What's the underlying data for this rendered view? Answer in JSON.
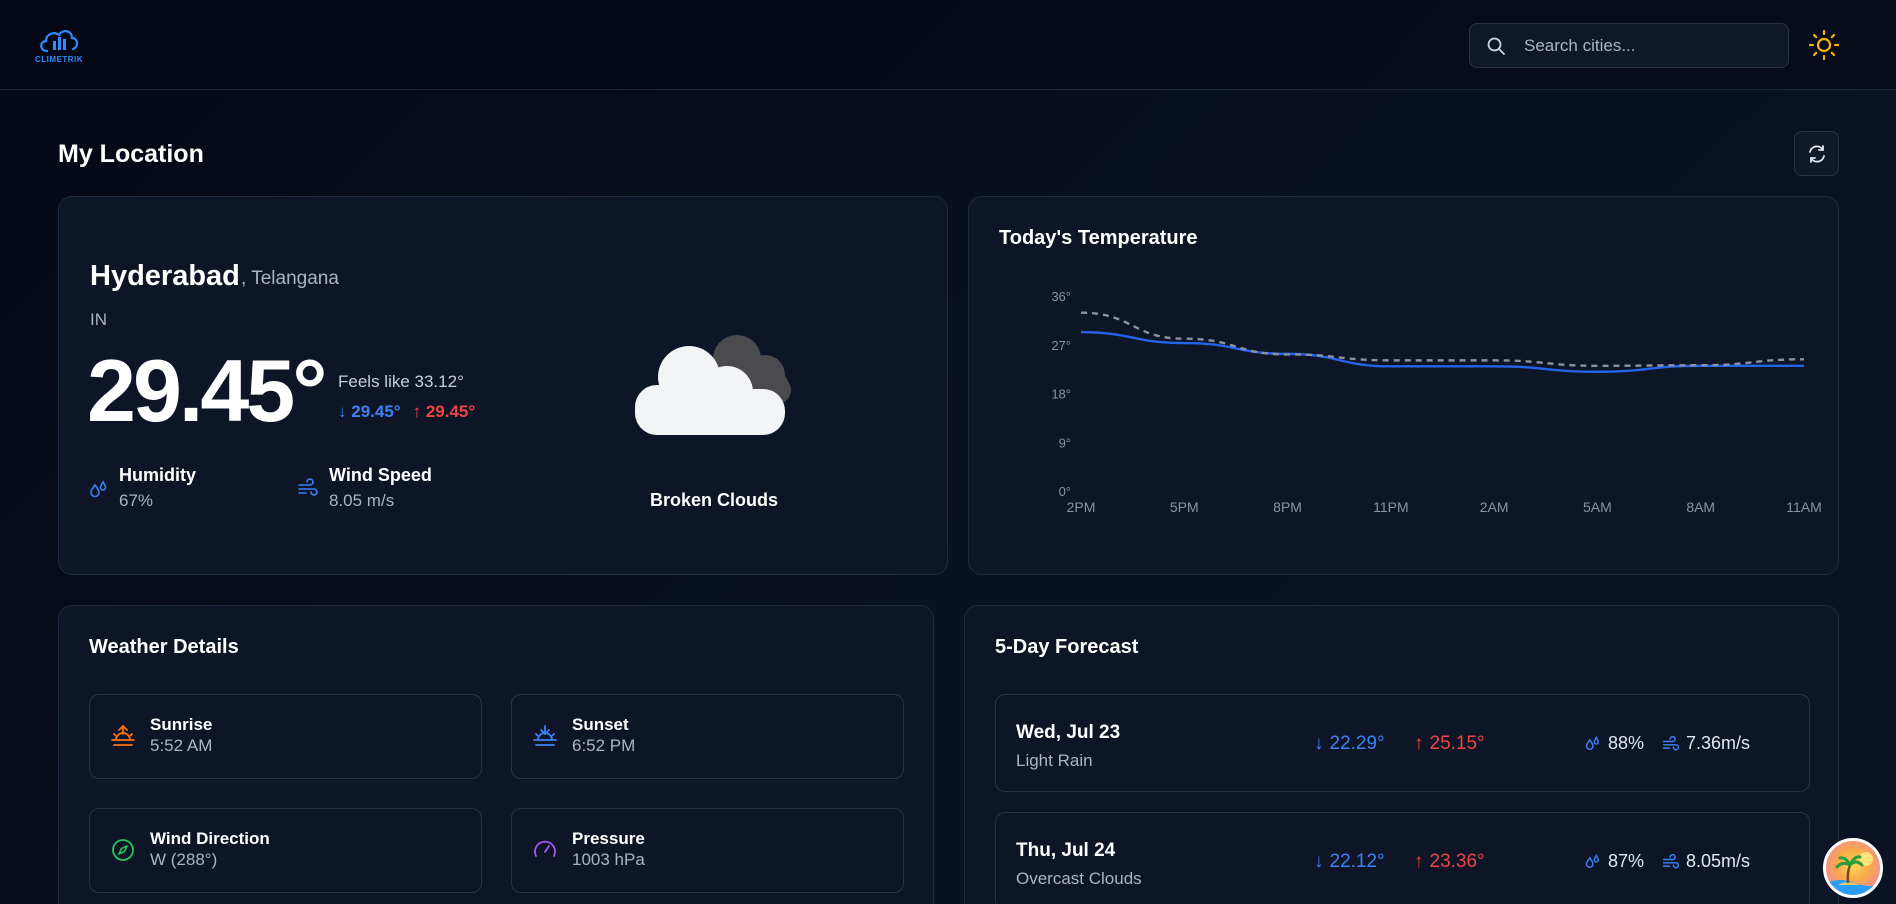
{
  "header": {
    "logo_text": "CLIMETRIK",
    "search_placeholder": "Search cities..."
  },
  "section_title": "My Location",
  "current": {
    "city": "Hyderabad",
    "region": ", Telangana",
    "country": "IN",
    "temp": "29.45°",
    "feels_like": "Feels like 33.12°",
    "min": "29.45°",
    "max": "29.45°",
    "humidity_label": "Humidity",
    "humidity_value": "67%",
    "wind_label": "Wind Speed",
    "wind_value": "8.05 m/s",
    "condition": "Broken Clouds"
  },
  "temp_chart": {
    "title": "Today's Temperature"
  },
  "chart_data": {
    "type": "line",
    "title": "Today's Temperature",
    "x": [
      "2PM",
      "5PM",
      "8PM",
      "11PM",
      "2AM",
      "5AM",
      "8AM",
      "11AM"
    ],
    "ylim": [
      0,
      36
    ],
    "yticks": [
      "0°",
      "9°",
      "18°",
      "27°",
      "36°"
    ],
    "series": [
      {
        "values": [
          29.5,
          27.5,
          25.5,
          23.2,
          23.2,
          22.2,
          23.3,
          23.3
        ],
        "color": "#2563eb",
        "style": "solid"
      },
      {
        "values": [
          33.1,
          28.3,
          25.4,
          24.3,
          24.3,
          23.3,
          23.4,
          24.5
        ],
        "color": "#8b93a3",
        "style": "dashed"
      }
    ],
    "grid": false
  },
  "details": {
    "title": "Weather Details",
    "sunrise_label": "Sunrise",
    "sunrise_value": "5:52 AM",
    "sunset_label": "Sunset",
    "sunset_value": "6:52 PM",
    "wind_dir_label": "Wind Direction",
    "wind_dir_value": "W (288°)",
    "pressure_label": "Pressure",
    "pressure_value": "1003 hPa"
  },
  "forecast": {
    "title": "5-Day Forecast",
    "days": [
      {
        "date": "Wed, Jul 23",
        "desc": "Light Rain",
        "min": "22.29°",
        "max": "25.15°",
        "humidity": "88%",
        "wind": "7.36m/s"
      },
      {
        "date": "Thu, Jul 24",
        "desc": "Overcast Clouds",
        "min": "22.12°",
        "max": "23.36°",
        "humidity": "87%",
        "wind": "8.05m/s"
      }
    ]
  },
  "colors": {
    "accent_blue": "#3b82f6",
    "accent_red": "#ef4444",
    "sun_yellow": "#f5b301"
  }
}
